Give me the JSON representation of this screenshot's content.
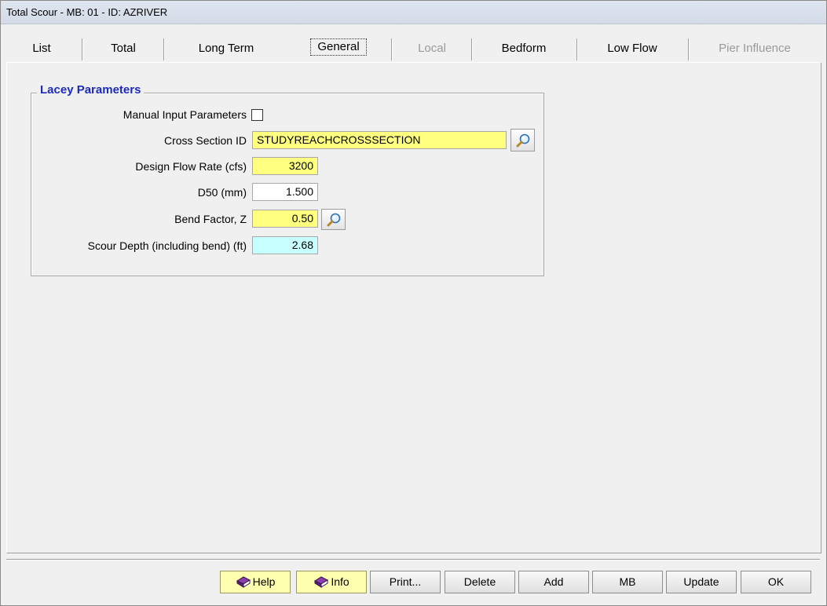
{
  "window": {
    "title": "Total Scour - MB: 01 - ID: AZRIVER"
  },
  "tabs": [
    {
      "label": "List",
      "state": "normal"
    },
    {
      "label": "Total",
      "state": "normal"
    },
    {
      "label": "Long Term",
      "state": "normal"
    },
    {
      "label": "General",
      "state": "selected"
    },
    {
      "label": "Local",
      "state": "disabled"
    },
    {
      "label": "Bedform",
      "state": "normal"
    },
    {
      "label": "Low Flow",
      "state": "normal"
    },
    {
      "label": "Pier Influence",
      "state": "disabled"
    }
  ],
  "group": {
    "title": "Lacey Parameters",
    "manual_input_label": "Manual Input Parameters",
    "manual_input_checked": false,
    "cross_section_label": "Cross Section ID",
    "cross_section_value": "STUDYREACHCROSSSECTION",
    "design_flow_label": "Design Flow Rate (cfs)",
    "design_flow_value": "3200",
    "d50_label": "D50 (mm)",
    "d50_value": "1.500",
    "bend_factor_label": "Bend Factor, Z",
    "bend_factor_value": "0.50",
    "scour_depth_label": "Scour Depth (including bend) (ft)",
    "scour_depth_value": "2.68"
  },
  "icons": {
    "lookup": "magnifier-icon",
    "book": "book-icon"
  },
  "colors": {
    "required_field": "#ffff80",
    "computed_field": "#c8ffff",
    "group_title": "#1c2bb8"
  },
  "buttons": {
    "help": "Help",
    "info": "Info",
    "print": "Print...",
    "delete": "Delete",
    "add": "Add",
    "mb": "MB",
    "update": "Update",
    "ok": "OK"
  }
}
